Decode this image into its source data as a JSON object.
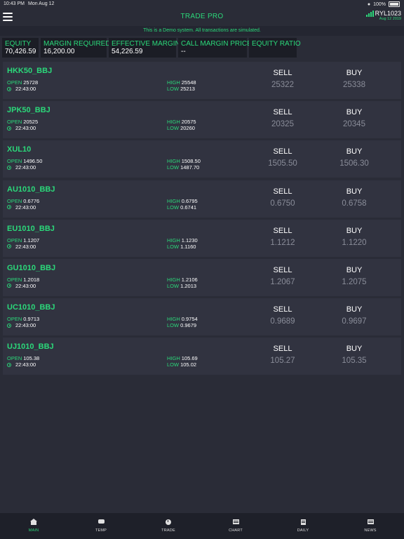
{
  "status_bar": {
    "time": "10:43 PM",
    "date": "Mon Aug 12",
    "battery": "100%"
  },
  "header": {
    "title": "TRADE PRO",
    "account_id": "RYL1023",
    "account_date": "Aug 12 2019"
  },
  "banner": "This is a Demo system. All transactions are simulated.",
  "summary": [
    {
      "label": "EQUITY",
      "value": "70,426.59"
    },
    {
      "label": "MARGIN REQUIRED",
      "value": "16,200.00"
    },
    {
      "label": "EFFECTIVE MARGIN",
      "value": "54,226.59"
    },
    {
      "label": "CALL MARGIN PRICE",
      "value": "--"
    },
    {
      "label": "EQUITY RATIO",
      "value": ""
    }
  ],
  "labels": {
    "open": "OPEN",
    "high": "HIGH",
    "low": "LOW",
    "sell": "SELL",
    "buy": "BUY"
  },
  "quotes": [
    {
      "symbol": "HKK50_BBJ",
      "open": "25728",
      "time": "22:43:00",
      "high": "25548",
      "low": "25213",
      "sell": "25322",
      "buy": "25338"
    },
    {
      "symbol": "JPK50_BBJ",
      "open": "20525",
      "time": "22:43:00",
      "high": "20575",
      "low": "20260",
      "sell": "20325",
      "buy": "20345"
    },
    {
      "symbol": "XUL10",
      "open": "1496.50",
      "time": "22:43:00",
      "high": "1508.50",
      "low": "1487.70",
      "sell": "1505.50",
      "buy": "1506.30"
    },
    {
      "symbol": "AU1010_BBJ",
      "open": "0.6776",
      "time": "22:43:00",
      "high": "0.6795",
      "low": "0.6741",
      "sell": "0.6750",
      "buy": "0.6758"
    },
    {
      "symbol": "EU1010_BBJ",
      "open": "1.1207",
      "time": "22:43:00",
      "high": "1.1230",
      "low": "1.1160",
      "sell": "1.1212",
      "buy": "1.1220"
    },
    {
      "symbol": "GU1010_BBJ",
      "open": "1.2018",
      "time": "22:43:00",
      "high": "1.2106",
      "low": "1.2013",
      "sell": "1.2067",
      "buy": "1.2075"
    },
    {
      "symbol": "UC1010_BBJ",
      "open": "0.9713",
      "time": "22:43:00",
      "high": "0.9754",
      "low": "0.9679",
      "sell": "0.9689",
      "buy": "0.9697"
    },
    {
      "symbol": "UJ1010_BBJ",
      "open": "105.38",
      "time": "22:43:00",
      "high": "105.69",
      "low": "105.02",
      "sell": "105.27",
      "buy": "105.35"
    }
  ],
  "tabs": [
    {
      "label": "MAIN",
      "icon": "home-icon",
      "active": true
    },
    {
      "label": "TEMP",
      "icon": "temp-icon",
      "active": false
    },
    {
      "label": "TRADE",
      "icon": "trade-icon",
      "active": false
    },
    {
      "label": "CHART",
      "icon": "chart-icon",
      "active": false
    },
    {
      "label": "DAILY",
      "icon": "daily-icon",
      "active": false
    },
    {
      "label": "NEWS",
      "icon": "news-icon",
      "active": false
    }
  ],
  "colors": {
    "accent": "#2bd97a",
    "background": "#2a2c37",
    "card": "#313340",
    "price_muted": "#8a8d99"
  }
}
